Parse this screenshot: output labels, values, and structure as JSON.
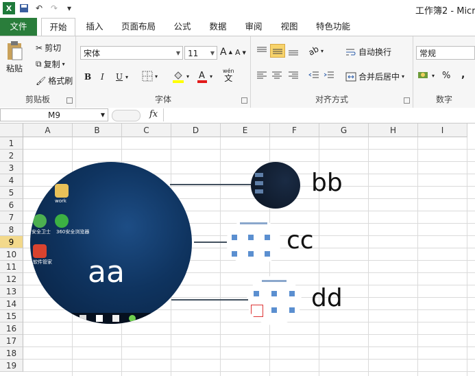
{
  "window": {
    "title": "工作簿2 - Micr"
  },
  "tabs": [
    "文件",
    "开始",
    "插入",
    "页面布局",
    "公式",
    "数据",
    "审阅",
    "视图",
    "特色功能"
  ],
  "ribbon": {
    "clipboard": {
      "paste": "粘贴",
      "cut": "剪切",
      "copy": "复制",
      "painter": "格式刷",
      "label": "剪贴板"
    },
    "font": {
      "name": "宋体",
      "size": "11",
      "bold": "B",
      "italic": "I",
      "underline": "U",
      "label": "字体",
      "wen": "wén",
      "wen_char": "文"
    },
    "align": {
      "wrap": "自动换行",
      "merge": "合并后居中",
      "label": "对齐方式"
    },
    "number": {
      "format": "常规",
      "percent": "%",
      "comma": ",",
      "label": "数字"
    }
  },
  "formula_bar": {
    "name_box": "M9",
    "fx": "fx"
  },
  "columns": [
    "A",
    "B",
    "C",
    "D",
    "E",
    "F",
    "G",
    "H",
    "I"
  ],
  "rows": [
    "1",
    "2",
    "3",
    "4",
    "5",
    "6",
    "7",
    "8",
    "9",
    "10",
    "11",
    "12",
    "13",
    "14",
    "15",
    "16",
    "17",
    "18",
    "19"
  ],
  "selected_row": "9",
  "desktop": {
    "icon1": "work",
    "icon2": "安全卫士",
    "icon3": "360安全浏览器",
    "icon4": "软件管家",
    "circle_label": "aa"
  },
  "callouts": [
    "bb",
    "cc",
    "dd"
  ]
}
